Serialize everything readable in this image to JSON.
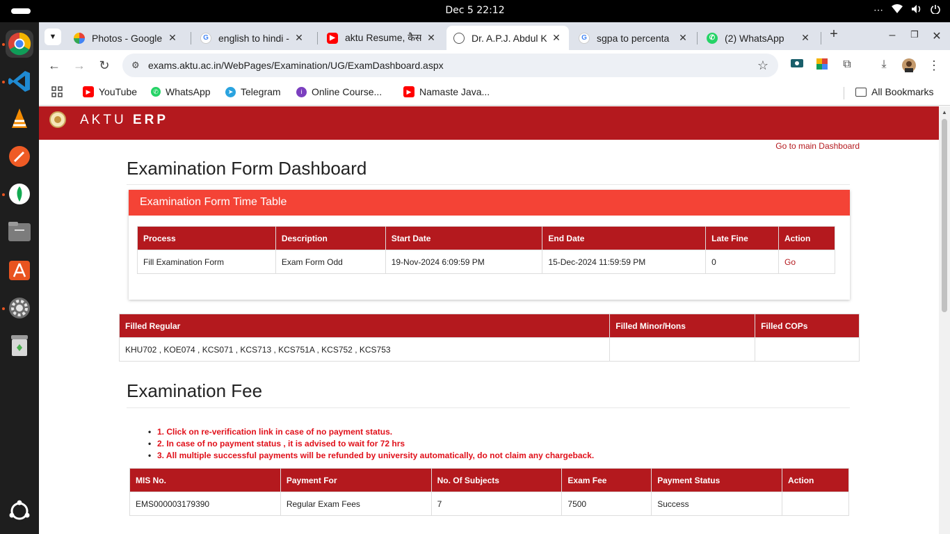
{
  "os": {
    "clock": "Dec 5  22:12",
    "tray": {
      "menu_icon": "⋯",
      "wifi_icon": "wifi-icon",
      "volume_icon": "volume-icon",
      "power_icon": "power-icon"
    }
  },
  "dock": {
    "apps": [
      "chrome",
      "vscode",
      "vlc",
      "postman",
      "mongodb-compass",
      "files",
      "app-center",
      "settings",
      "trash",
      "ubuntu-apps"
    ]
  },
  "browser": {
    "tabs": [
      {
        "label": "Photos - Google",
        "favicon": "google-photos"
      },
      {
        "label": "english to hindi -",
        "favicon": "google"
      },
      {
        "label": "aktu Resume, कैस",
        "favicon": "youtube"
      },
      {
        "label": "Dr. A.P.J. Abdul K",
        "favicon": "globe",
        "active": true
      },
      {
        "label": "sgpa to percenta",
        "favicon": "google"
      },
      {
        "label": "(2) WhatsApp",
        "favicon": "whatsapp"
      }
    ],
    "tab_close": "✕",
    "new_tab": "+",
    "url": "exams.aktu.ac.in/WebPages/Examination/UG/ExamDashboard.aspx",
    "bookmarks": [
      {
        "label": "YouTube",
        "icon": "youtube"
      },
      {
        "label": "WhatsApp",
        "icon": "whatsapp"
      },
      {
        "label": "Telegram",
        "icon": "telegram"
      },
      {
        "label": "Online Course...",
        "icon": "online-course"
      },
      {
        "label": "Namaste Java...",
        "icon": "youtube"
      }
    ],
    "all_bookmarks": "All Bookmarks"
  },
  "page": {
    "brand_light": "AKTU ",
    "brand_bold": "ERP",
    "main_dashboard_link": "Go to main Dashboard",
    "title": "Examination Form Dashboard",
    "timetable": {
      "title": "Examination Form Time Table",
      "headers": [
        "Process",
        "Description",
        "Start Date",
        "End Date",
        "Late Fine",
        "Action"
      ],
      "rows": [
        [
          "Fill Examination Form",
          "Exam Form Odd",
          "19-Nov-2024 6:09:59 PM",
          "15-Dec-2024 11:59:59 PM",
          "0",
          "Go"
        ]
      ]
    },
    "filled": {
      "headers": [
        "Filled Regular",
        "Filled Minor/Hons",
        "Filled COPs"
      ],
      "rows": [
        [
          "KHU702 , KOE074 , KCS071 , KCS713 , KCS751A , KCS752 , KCS753",
          "",
          ""
        ]
      ]
    },
    "fee": {
      "title": "Examination Fee",
      "notes": [
        "1. Click on re-verification link in case of no payment status.",
        "2. In case of no payment status , it is advised to wait for 72 hrs",
        "3. All multiple successful payments will be refunded by university automatically, do not claim any chargeback."
      ],
      "headers": [
        "MIS No.",
        "Payment For",
        "No. Of Subjects",
        "Exam Fee",
        "Payment Status",
        "Action"
      ],
      "rows": [
        [
          "EMS000003179390",
          "Regular Exam Fees",
          "7",
          "7500",
          "Success",
          ""
        ]
      ]
    }
  },
  "colors": {
    "brand_red": "#b4191e",
    "panel_header": "#f44336",
    "note_red": "#e0101a"
  }
}
